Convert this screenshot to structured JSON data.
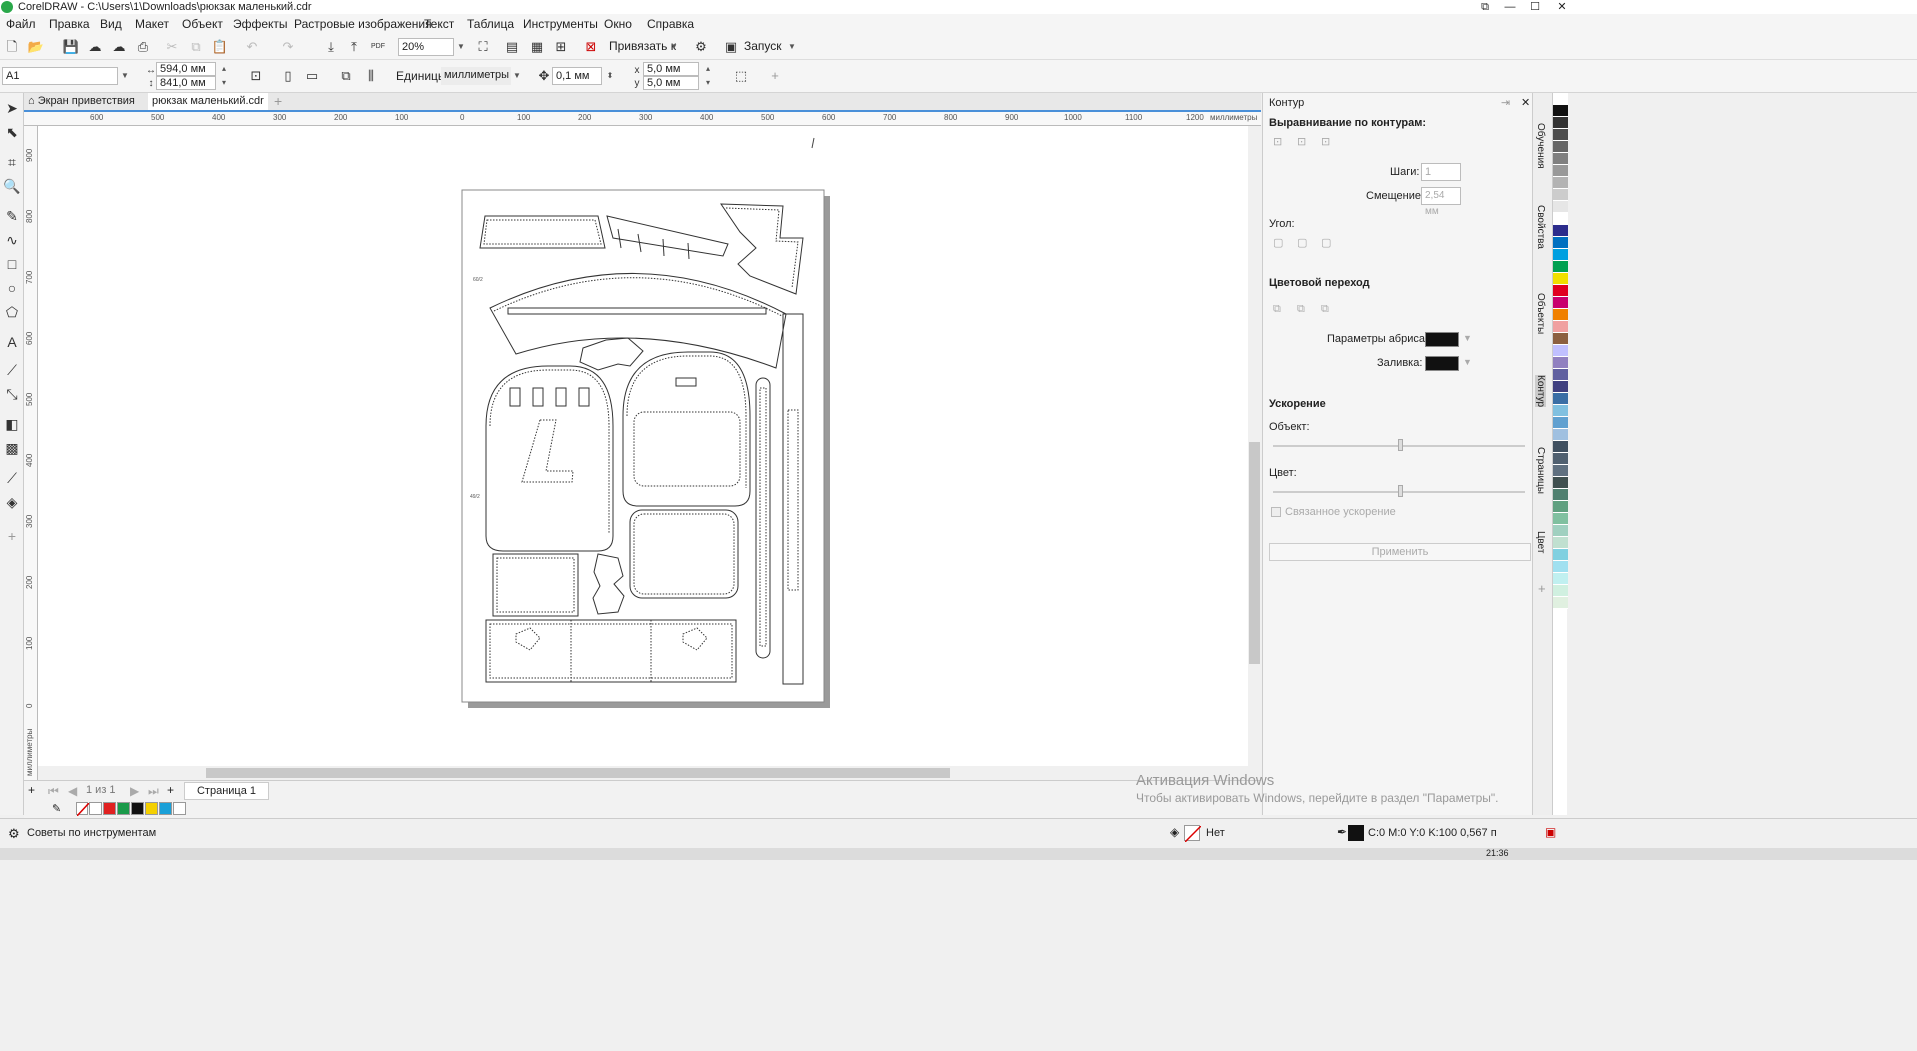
{
  "window": {
    "title": "CorelDRAW - C:\\Users\\1\\Downloads\\рюкзак маленький.cdr",
    "controls": [
      "⧉",
      "—",
      "☐",
      "✕"
    ]
  },
  "menu": {
    "items": [
      "Файл",
      "Правка",
      "Вид",
      "Макет",
      "Объект",
      "Эффекты",
      "Растровые изображения",
      "Текст",
      "Таблица",
      "Инструменты",
      "Окно",
      "Справка"
    ]
  },
  "toolbar1": {
    "zoom": "20%",
    "snap_label": "Привязать к",
    "launch_label": "Запуск"
  },
  "toolbar2": {
    "page_preset": "A1",
    "width": "594,0 мм",
    "height": "841,0 мм",
    "units_label": "Единицы:",
    "units_value": "миллиметры",
    "nudge": "0,1 мм",
    "dup_x": "5,0 мм",
    "dup_y": "5,0 мм"
  },
  "doc_tabs": {
    "welcome": "Экран приветствия",
    "file": "рюкзак маленький.cdr"
  },
  "rulers": {
    "h_labels": [
      "600",
      "500",
      "400",
      "300",
      "200",
      "100",
      "0",
      "100",
      "200",
      "300",
      "400",
      "500",
      "600",
      "700",
      "800",
      "900",
      "1000",
      "1100",
      "1200"
    ],
    "unit": "миллиметры",
    "v_labels": [
      "900",
      "800",
      "700",
      "600",
      "500",
      "400",
      "300",
      "200",
      "100",
      "0"
    ]
  },
  "canvas": {
    "label_a": "60/2",
    "label_b": "49/2"
  },
  "page_nav": {
    "counter": "1 из 1",
    "page_tab": "Страница 1"
  },
  "doc_palette": [
    "#ffffff",
    "#e02020",
    "#1a9a4a",
    "#111111",
    "#f5d000",
    "#1aa0d8",
    "#ffffff"
  ],
  "panel": {
    "title": "Контур",
    "align_heading": "Выравнивание по контурам:",
    "steps_label": "Шаги:",
    "steps_value": "1",
    "offset_label": "Смещение:",
    "offset_value": "2,54 мм",
    "angle_label": "Угол:",
    "blend_heading": "Цветовой переход",
    "outline_params_label": "Параметры абриса:",
    "fill_label": "Заливка:",
    "accel_heading": "Ускорение",
    "object_label": "Объект:",
    "color_label": "Цвет:",
    "linked_label": "Связанное ускорение",
    "apply_label": "Применить"
  },
  "side_tabs": [
    "Обучения",
    "Свойства",
    "Объекты",
    "Контур",
    "Страницы",
    "Цвет"
  ],
  "color_strip": [
    "#ffffff",
    "#111111",
    "#333333",
    "#4d4d4d",
    "#666666",
    "#808080",
    "#999999",
    "#b3b3b3",
    "#cccccc",
    "#e6e6e6",
    "#ffffff",
    "#2c2c8c",
    "#0070c0",
    "#00a0e0",
    "#00a050",
    "#f0e000",
    "#e00020",
    "#c8006e",
    "#f08000",
    "#f0a0a0",
    "#8c6040",
    "#c0c0ff",
    "#9080c0",
    "#6060a0",
    "#404080",
    "#3a6ea5",
    "#80c0e0",
    "#60a0d0",
    "#a0c0e0",
    "#405060",
    "#506070",
    "#607080",
    "#405050",
    "#508070",
    "#60a080",
    "#80c0a0",
    "#a0d0c0",
    "#c0e0d0",
    "#80d0e0",
    "#a0e0f0",
    "#c0f0f0",
    "#d0f0e0",
    "#e0f0e0"
  ],
  "status": {
    "tips": "Советы по инструментам",
    "fill_none": "Нет",
    "outline_info": "C:0 M:0 Y:0 K:100  0,567 п"
  },
  "watermark": {
    "line1": "Активация Windows",
    "line2": "Чтобы активировать Windows, перейдите в раздел \"Параметры\"."
  },
  "clock": "21:36"
}
